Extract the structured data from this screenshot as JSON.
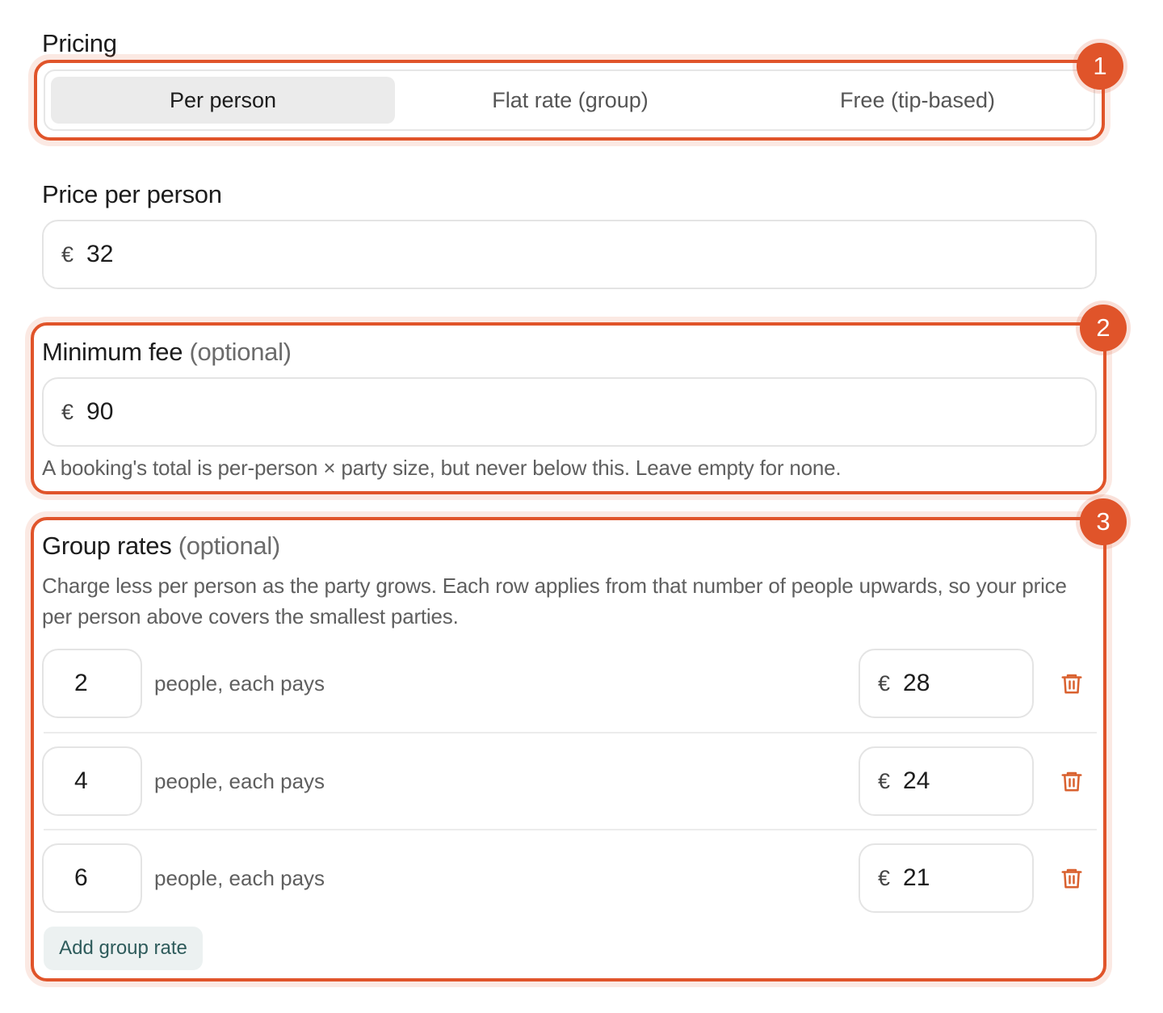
{
  "pricing": {
    "label": "Pricing",
    "options": [
      "Per person",
      "Flat rate (group)",
      "Free (tip-based)"
    ],
    "selected": "Per person"
  },
  "price_per_person": {
    "label": "Price per person",
    "currency": "€",
    "value": "32"
  },
  "minimum_fee": {
    "label": "Minimum fee",
    "optional": "(optional)",
    "currency": "€",
    "value": "90",
    "helper": "A booking's total is per-person × party size, but never below this. Leave empty for none."
  },
  "group_rates": {
    "label": "Group rates",
    "optional": "(optional)",
    "description": "Charge less per person as the party grows. Each row applies from that number of people upwards, so your price per person above covers the smallest parties.",
    "row_label": "people, each pays",
    "currency": "€",
    "rows": [
      {
        "people": "2",
        "price": "28"
      },
      {
        "people": "4",
        "price": "24"
      },
      {
        "people": "6",
        "price": "21"
      }
    ],
    "add_label": "Add group rate"
  },
  "annotations": [
    "1",
    "2",
    "3"
  ],
  "colors": {
    "accent": "#e0542a",
    "add_button_bg": "#ecf1f1",
    "add_button_text": "#2e5b5b",
    "trash_icon": "#d9612f"
  }
}
